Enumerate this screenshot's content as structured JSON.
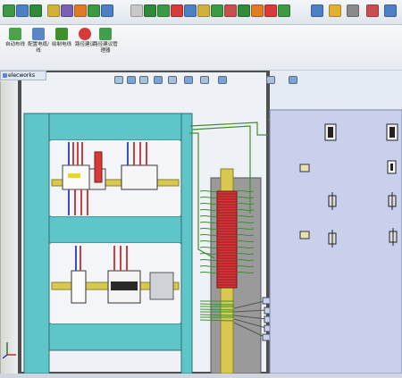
{
  "toolbar": {
    "icons": [
      "new-icon",
      "open-icon",
      "save-icon",
      "print-icon",
      "undo-icon",
      "redo-icon",
      "select-icon",
      "rebuild-icon",
      "options-icon",
      "help-icon",
      "electrical-icon",
      "wire-icon",
      "harness-icon",
      "route-icon",
      "component-icon",
      "connector-icon",
      "clip-icon",
      "cable-icon",
      "edit-route-icon",
      "flatten-icon",
      "view-icon",
      "folder-icon",
      "settings-icon",
      "tools-icon",
      "close-icon"
    ]
  },
  "ribbon": {
    "buttons": [
      {
        "label": "自动布线",
        "icon": "auto-route-icon"
      },
      {
        "label": "配置电缆/线",
        "icon": "cable-config-icon"
      },
      {
        "label": "绘制电线",
        "icon": "draw-wire-icon"
      },
      {
        "label": "路径建议",
        "icon": "route-suggest-icon"
      },
      {
        "label": "路径建议管理器",
        "icon": "route-manager-icon"
      }
    ]
  },
  "tree_tab": {
    "label": "elecworks"
  },
  "colors": {
    "cyan_frame": "#5ec6c9",
    "panel_bg": "#ebeff6",
    "right_bg": "#c8d0ec",
    "wire_green": "#3f8f2d",
    "terminal_red": "#d7353a",
    "din_rail": "#d8c84f"
  }
}
